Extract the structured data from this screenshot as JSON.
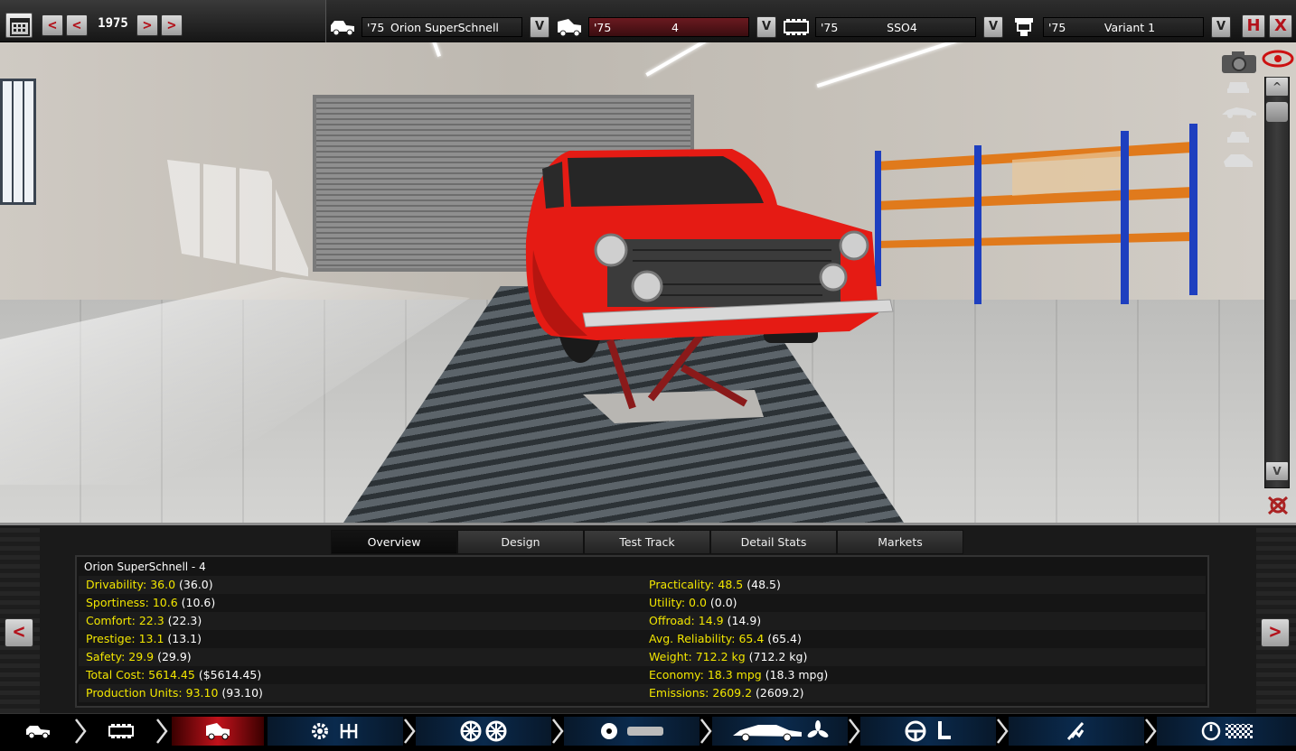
{
  "top": {
    "year": "1975",
    "prev_btn_1": "<",
    "prev_btn_2": "<",
    "next_btn_1": ">",
    "next_btn_2": ">",
    "selectors": [
      {
        "icon": "car-model-icon",
        "year": "'75",
        "name": "Orion SuperSchnell",
        "dropdown": "V"
      },
      {
        "icon": "trim-icon",
        "year": "'75",
        "name": "4",
        "dropdown": "V"
      },
      {
        "icon": "engine-icon",
        "year": "'75",
        "name": "SSO4",
        "dropdown": "V"
      },
      {
        "icon": "engine-variant-icon",
        "year": "'75",
        "name": "Variant 1",
        "dropdown": "V"
      }
    ],
    "save_label": "H",
    "close_label": "X"
  },
  "viewport": {
    "scroll_up": "^",
    "scroll_down": "V",
    "view_icons": [
      "camera-icon",
      "eye-icon",
      "front-view-icon",
      "side-view-icon",
      "rear-view-icon",
      "three-quarter-view-icon"
    ]
  },
  "tabs": [
    {
      "label": "Overview",
      "active": true
    },
    {
      "label": "Design",
      "active": false
    },
    {
      "label": "Test Track",
      "active": false
    },
    {
      "label": "Detail Stats",
      "active": false
    },
    {
      "label": "Markets",
      "active": false
    }
  ],
  "stats": {
    "title": "Orion SuperSchnell - 4",
    "left": [
      {
        "label": "Drivability: 36.0",
        "paren": "(36.0)"
      },
      {
        "label": "Sportiness: 10.6",
        "paren": "(10.6)"
      },
      {
        "label": "Comfort: 22.3",
        "paren": "(22.3)"
      },
      {
        "label": "Prestige: 13.1",
        "paren": "(13.1)"
      },
      {
        "label": "Safety: 29.9",
        "paren": "(29.9)"
      },
      {
        "label": "Total Cost: 5614.45",
        "paren": "($5614.45)"
      },
      {
        "label": "Production Units: 93.10",
        "paren": "(93.10)"
      }
    ],
    "right": [
      {
        "label": "Practicality: 48.5",
        "paren": "(48.5)"
      },
      {
        "label": "Utility: 0.0",
        "paren": "(0.0)"
      },
      {
        "label": "Offroad: 14.9",
        "paren": "(14.9)"
      },
      {
        "label": "Avg. Reliability: 65.4",
        "paren": "(65.4)"
      },
      {
        "label": "Weight: 712.2 kg",
        "paren": "(712.2 kg)"
      },
      {
        "label": "Economy: 18.3 mpg",
        "paren": "(18.3 mpg)"
      },
      {
        "label": "Emissions: 2609.2",
        "paren": "(2609.2)"
      }
    ],
    "prev_arrow": "<",
    "next_arrow": ">"
  },
  "nav": [
    {
      "name": "nav-car-model",
      "icons": [
        "car-model-icon"
      ]
    },
    {
      "name": "nav-engine-overview",
      "icons": [
        "engine-block-icon"
      ]
    },
    {
      "name": "nav-trim",
      "icons": [
        "trim-icon"
      ],
      "active": true
    },
    {
      "name": "nav-drivetrain",
      "icons": [
        "gear-icon",
        "gearshift-icon"
      ]
    },
    {
      "name": "nav-wheels",
      "icons": [
        "wheel-icon",
        "wheel-icon"
      ]
    },
    {
      "name": "nav-brakes-suspension",
      "icons": [
        "brake-disc-icon",
        "chassis-icon"
      ]
    },
    {
      "name": "nav-aero-cooling",
      "icons": [
        "sports-car-icon",
        "fan-icon"
      ]
    },
    {
      "name": "nav-interior",
      "icons": [
        "steering-wheel-icon",
        "seat-icon"
      ]
    },
    {
      "name": "nav-suspension-tuning",
      "icons": [
        "shock-absorber-icon"
      ]
    },
    {
      "name": "nav-test",
      "icons": [
        "gauge-icon",
        "checkered-flag-icon"
      ]
    }
  ],
  "colors": {
    "accent_red": "#b3121b",
    "stat_label": "#f2e600",
    "nav_blue": "#0a2a4d"
  }
}
